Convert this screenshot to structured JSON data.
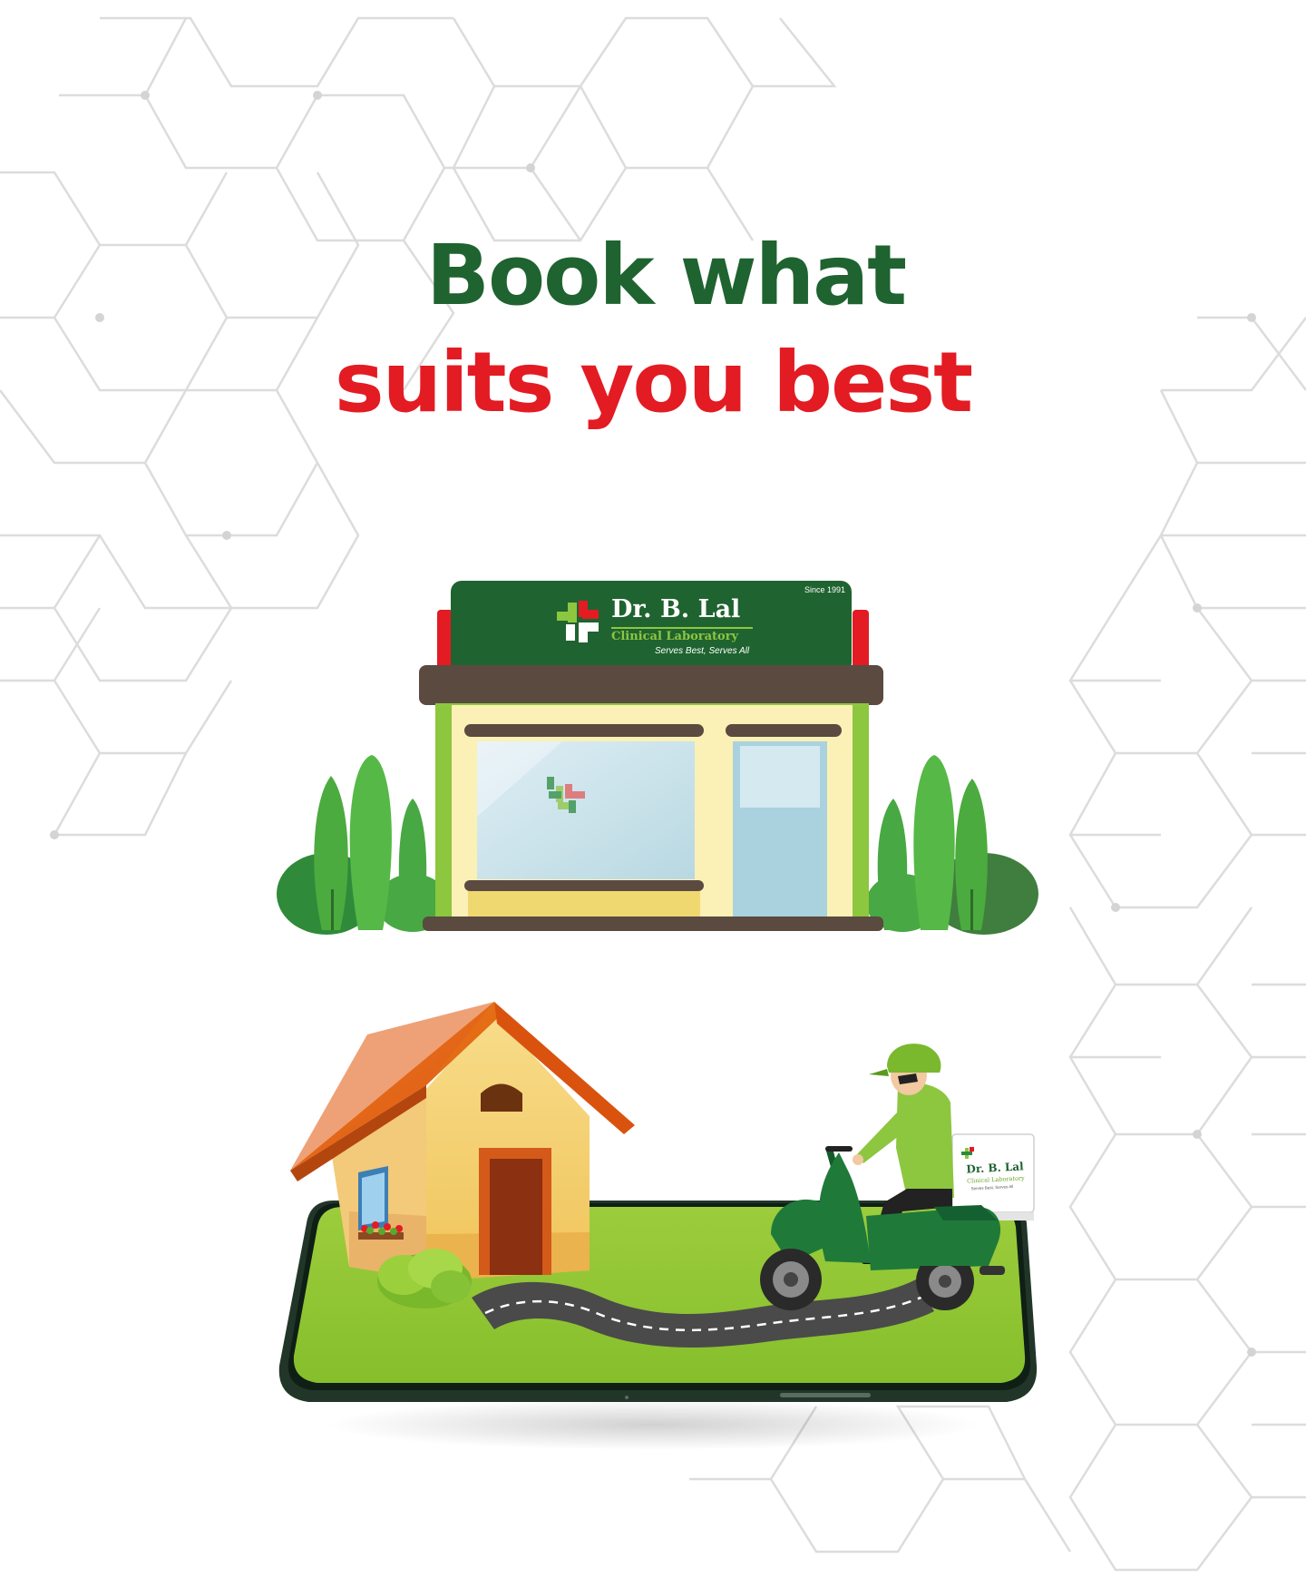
{
  "headline": {
    "line1": "Book what",
    "line2": "suits you best"
  },
  "colors": {
    "brand_green": "#1f6330",
    "brand_red": "#e31b23",
    "leaf_green": "#8dc63f",
    "road_gray": "#4a4a4a",
    "pattern_gray": "#d9d9d9"
  },
  "lab_sign": {
    "since": "Since 1991",
    "name": "Dr. B. Lal",
    "subtitle": "Clinical Laboratory",
    "tagline": "Serves Best, Serves All"
  },
  "delivery_box": {
    "name": "Dr. B. Lal",
    "subtitle": "Clinical Laboratory",
    "tagline": "Serves Best, Serves All"
  },
  "icons": {
    "brand_logo": "plus-heart-logo-icon",
    "window_logo": "plus-heart-logo-icon"
  }
}
